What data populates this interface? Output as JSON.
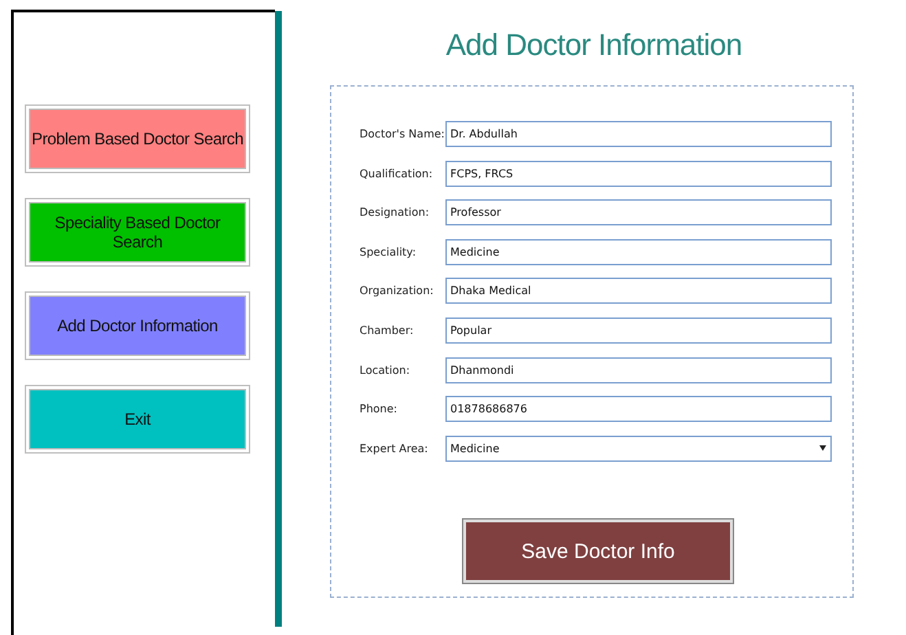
{
  "sidebar": {
    "buttons": [
      {
        "label": "Problem Based Doctor Search",
        "color": "#ff8080"
      },
      {
        "label": "Speciality Based Doctor Search",
        "color": "#00c000"
      },
      {
        "label": "Add Doctor Information",
        "color": "#8080ff"
      },
      {
        "label": "Exit",
        "color": "#00c0c0"
      }
    ]
  },
  "form": {
    "title": "Add Doctor Information",
    "fields": [
      {
        "kind": "text",
        "label": "Doctor's Name:",
        "value": "Dr. Abdullah"
      },
      {
        "kind": "text",
        "label": "Qualification:",
        "value": "FCPS, FRCS"
      },
      {
        "kind": "text",
        "label": "Designation:",
        "value": "Professor"
      },
      {
        "kind": "text",
        "label": "Speciality:",
        "value": "Medicine"
      },
      {
        "kind": "text",
        "label": "Organization:",
        "value": "Dhaka Medical"
      },
      {
        "kind": "text",
        "label": "Chamber:",
        "value": "Popular"
      },
      {
        "kind": "text",
        "label": "Location:",
        "value": "Dhanmondi"
      },
      {
        "kind": "text",
        "label": "Phone:",
        "value": "01878686876"
      },
      {
        "kind": "dropdown",
        "label": "Expert Area:",
        "value": "Medicine"
      }
    ],
    "save_button": "Save Doctor Info"
  }
}
